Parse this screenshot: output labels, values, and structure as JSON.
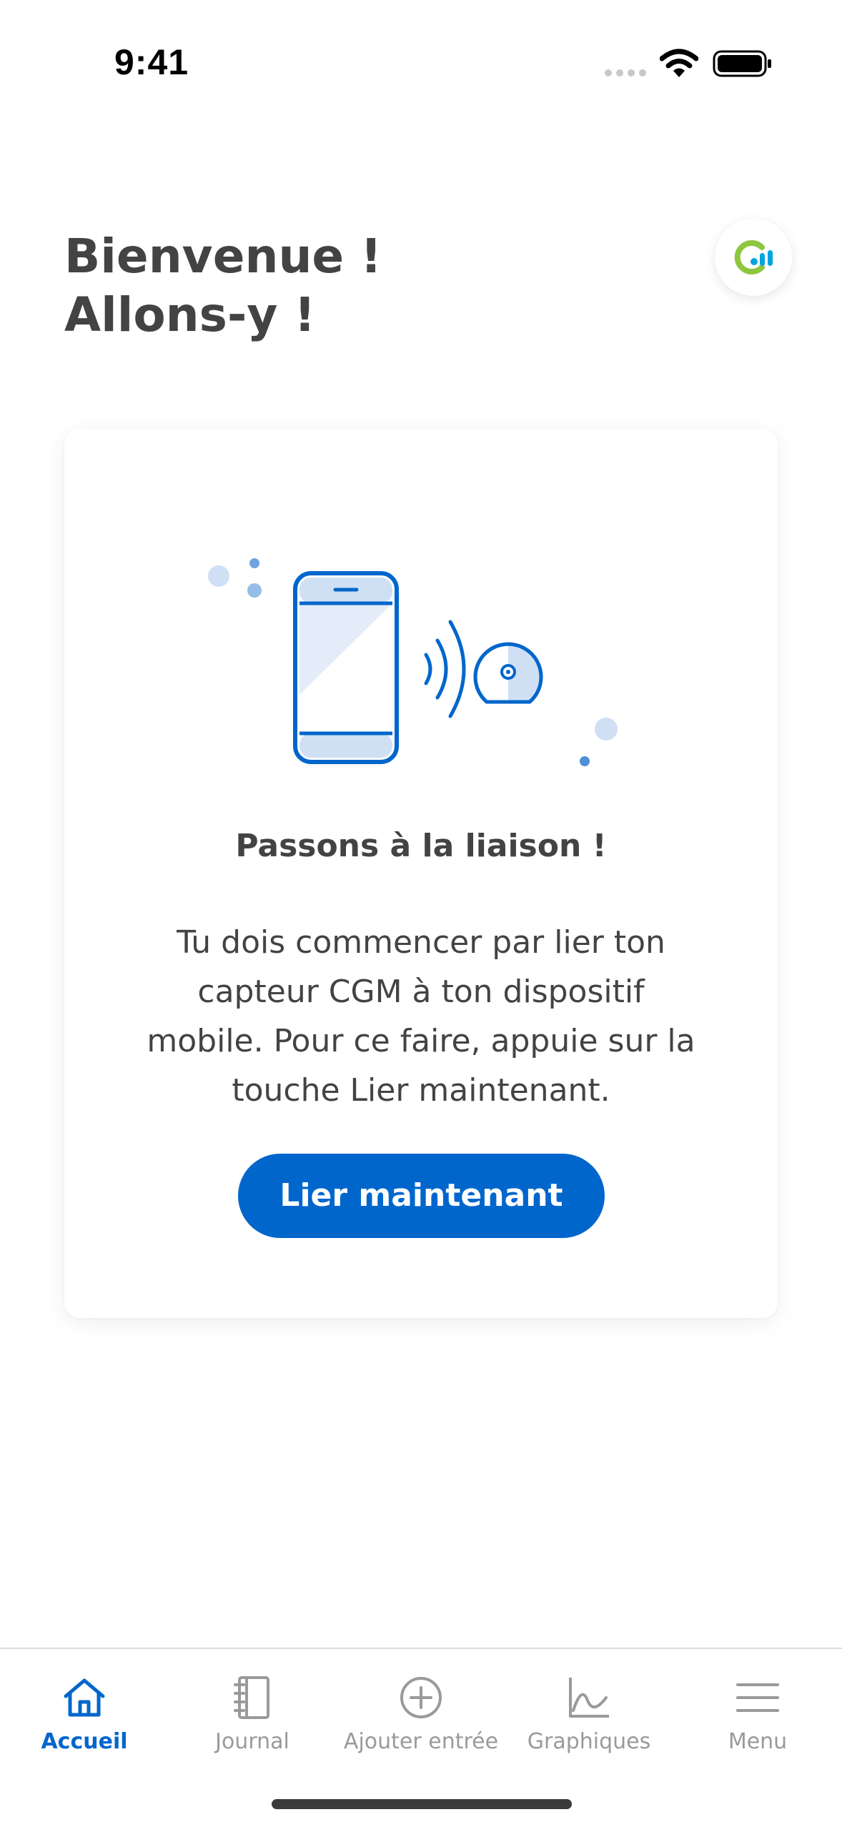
{
  "status_bar": {
    "time": "9:41"
  },
  "header": {
    "welcome_line1": "Bienvenue !",
    "welcome_line2": "Allons-y !",
    "logo_icon": "app-logo-icon"
  },
  "card": {
    "title": "Passons à la liaison !",
    "body_lines": [
      "Tu dois commencer par lier ton",
      "capteur CGM à ton dispositif",
      "mobile. Pour ce faire, appuie sur la",
      "touche Lier maintenant."
    ],
    "button_label": "Lier maintenant"
  },
  "tab_bar": {
    "items": [
      {
        "label": "Accueil",
        "icon": "home-icon",
        "active": true
      },
      {
        "label": "Journal",
        "icon": "journal-icon",
        "active": false
      },
      {
        "label": "Ajouter entrée",
        "icon": "add-entry-icon",
        "active": false
      },
      {
        "label": "Graphiques",
        "icon": "chart-icon",
        "active": false
      },
      {
        "label": "Menu",
        "icon": "menu-icon",
        "active": false
      }
    ]
  },
  "colors": {
    "accent": "#0066cc",
    "text": "#434343",
    "inactive": "#9a9a9a",
    "logo_green": "#8dc63f",
    "logo_blue": "#00a3e0"
  }
}
